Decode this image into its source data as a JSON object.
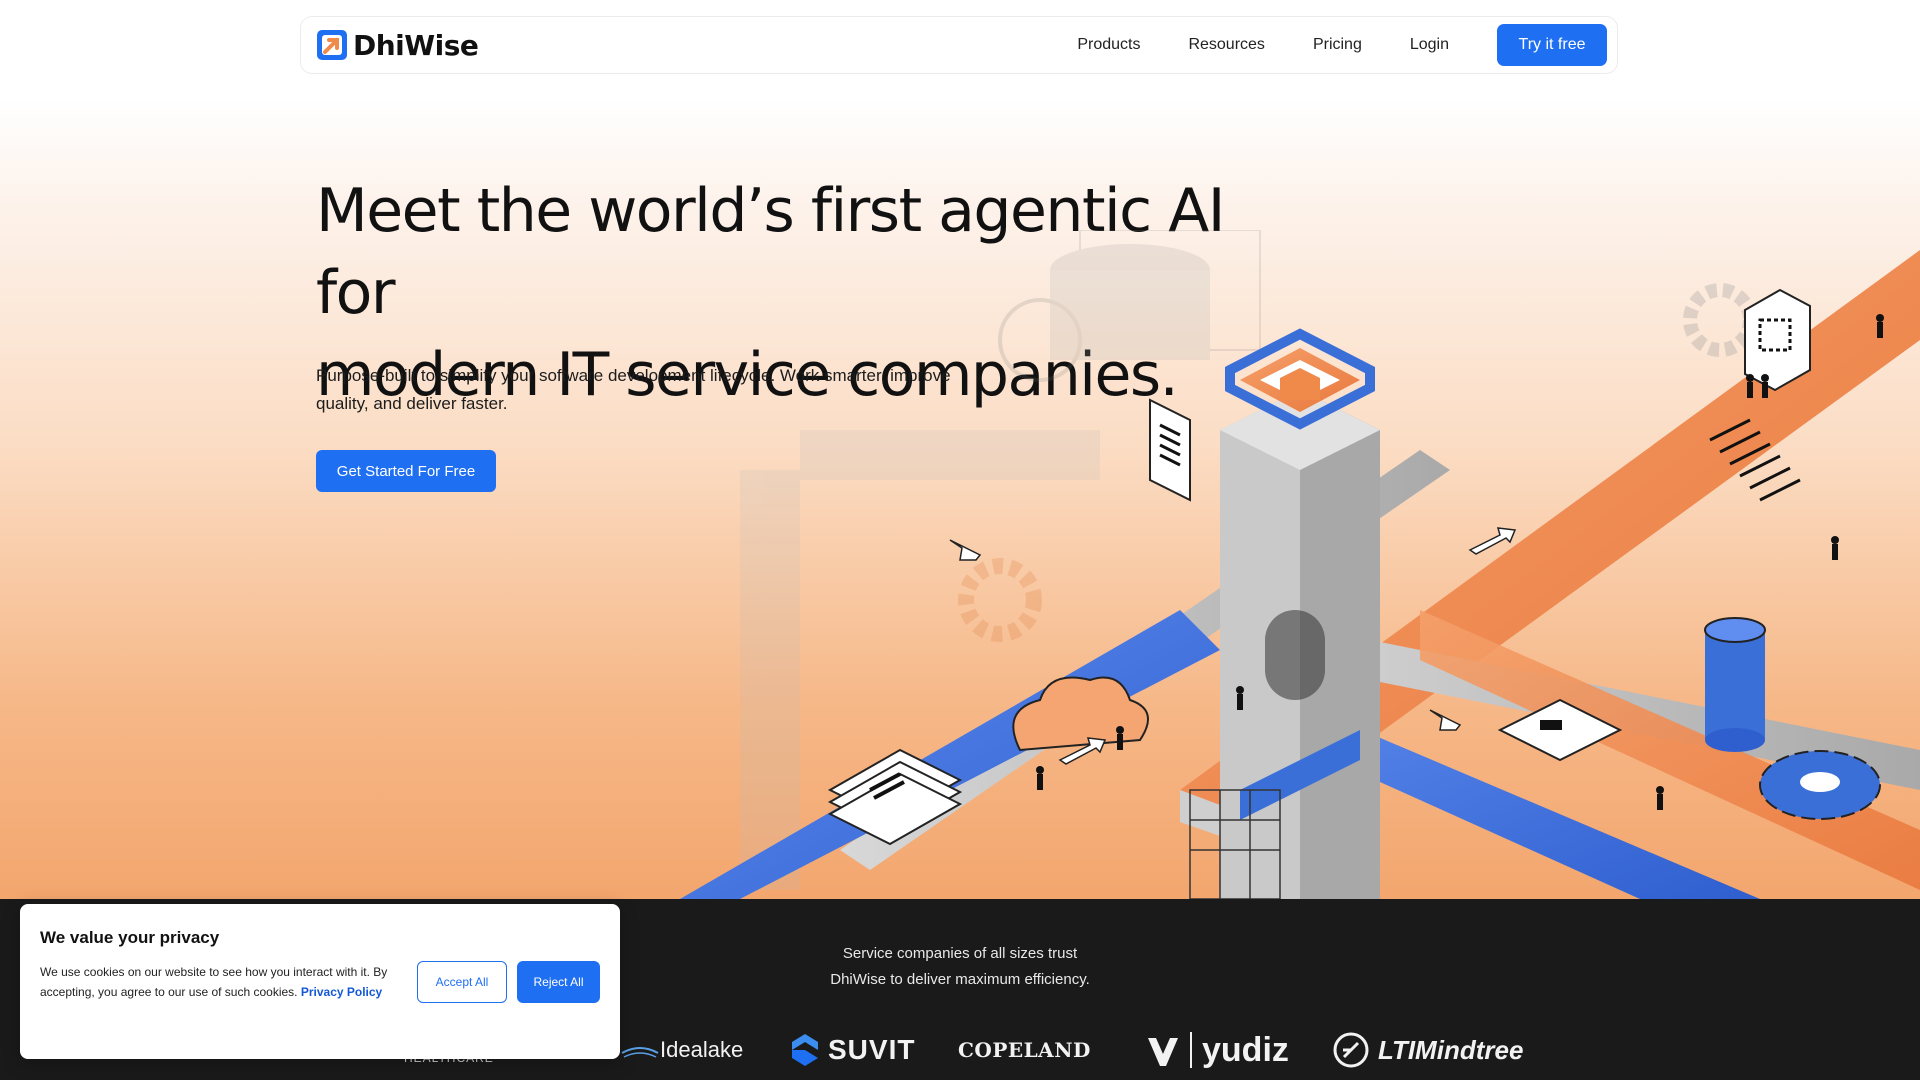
{
  "nav": {
    "brand": "DhiWise",
    "links": [
      "Products",
      "Resources",
      "Pricing",
      "Login"
    ],
    "cta": "Try it free"
  },
  "hero": {
    "title_line1": "Meet the world’s first agentic AI for",
    "title_line2": "modern IT service companies.",
    "subtitle_line1": "Purpose-built to simplify your software development lifecycle. Work smarter, improve",
    "subtitle_line2": "quality, and deliver faster.",
    "cta": "Get Started For Free"
  },
  "trust": {
    "line1": "Service companies of all sizes trust",
    "line2": "DhiWise to deliver maximum efficiency.",
    "logos": {
      "healthcare": "HEALTHCARE",
      "idealake": "Idealake",
      "suvit": "SUVIT",
      "copeland": "COPELAND",
      "yudiz": "yudiz",
      "ltimindtree": "LTIMindtree"
    }
  },
  "cookie": {
    "title": "We value your privacy",
    "body": "We use cookies on our website to see how you interact with it. By accepting, you agree to our use of such cookies.",
    "link": "Privacy Policy",
    "accept": "Accept All",
    "reject": "Reject All"
  },
  "colors": {
    "accent": "#1f6ff2",
    "dark_band": "#1a1a1a",
    "orange": "#f08a4b",
    "blue_illustration": "#3b6fd8"
  }
}
